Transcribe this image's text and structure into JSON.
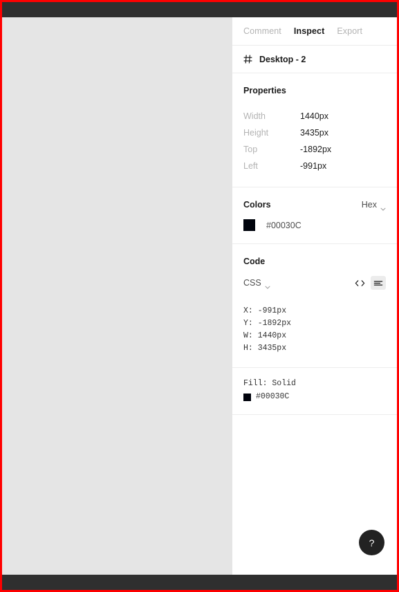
{
  "window": {
    "canvas_background": "#e5e5e5",
    "chrome_color": "#2f2f2f",
    "highlight_border": "#ff0000"
  },
  "panel": {
    "tabs": [
      {
        "label": "Comment",
        "active": false
      },
      {
        "label": "Inspect",
        "active": true
      },
      {
        "label": "Export",
        "active": false
      }
    ],
    "selection": {
      "icon": "frame-hash-icon",
      "name": "Desktop - 2"
    },
    "properties": {
      "title": "Properties",
      "rows": [
        {
          "label": "Width",
          "value": "1440px"
        },
        {
          "label": "Height",
          "value": "3435px"
        },
        {
          "label": "Top",
          "value": "-1892px"
        },
        {
          "label": "Left",
          "value": "-991px"
        }
      ]
    },
    "colors": {
      "title": "Colors",
      "format": "Hex",
      "items": [
        {
          "swatch": "#00030C",
          "value": "#00030C"
        }
      ]
    },
    "code": {
      "title": "Code",
      "language": "CSS",
      "view_icons": [
        {
          "name": "code-brackets-icon",
          "selected": false
        },
        {
          "name": "list-lines-icon",
          "selected": true
        }
      ],
      "snippet": "X: -991px\nY: -1892px\nW: 1440px\nH: 3435px",
      "fill_label": "Fill: Solid",
      "fill_swatch": "#00030C",
      "fill_value": "#00030C"
    },
    "help_button": {
      "label": "?"
    }
  }
}
